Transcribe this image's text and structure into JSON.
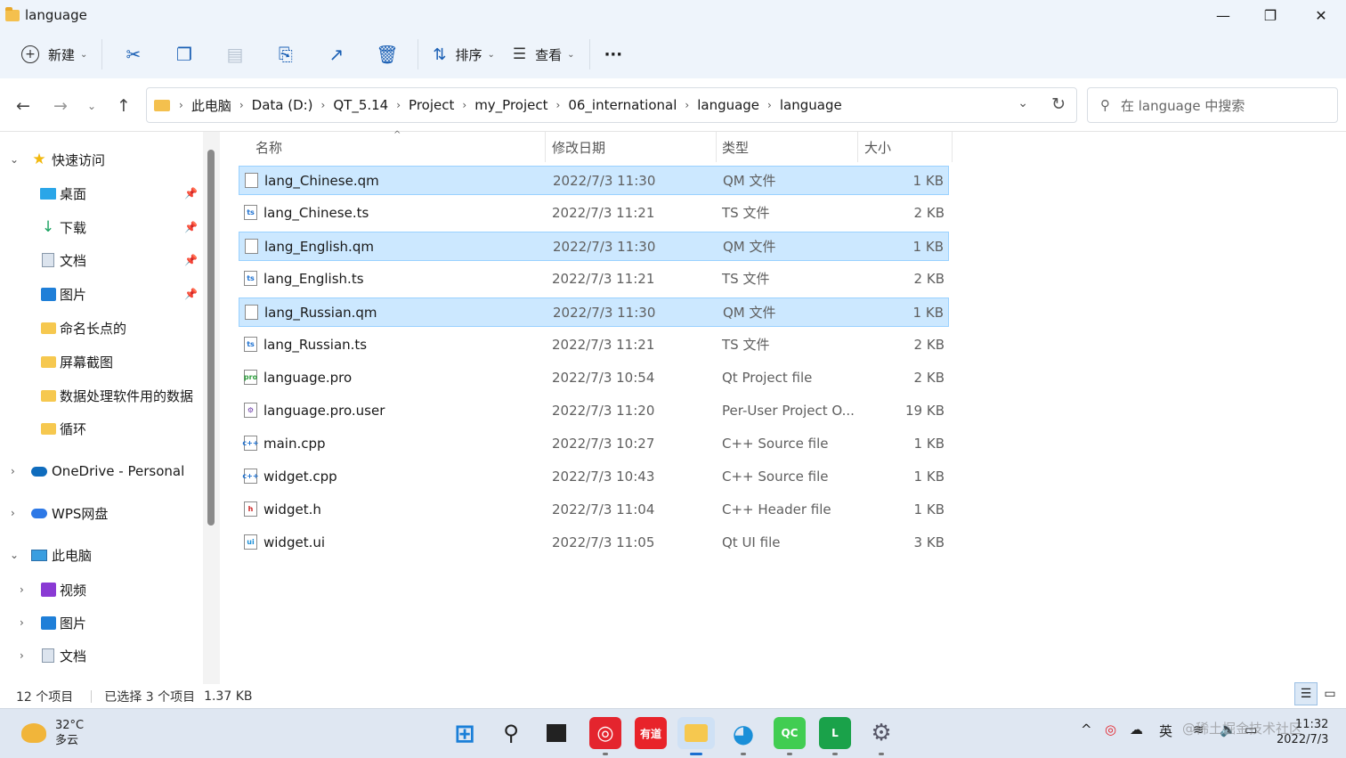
{
  "window": {
    "title": "language",
    "minimize": "—",
    "maximize": "❐",
    "close": "✕"
  },
  "toolbar": {
    "new_label": "新建",
    "sort_label": "排序",
    "view_label": "查看",
    "more_label": "···"
  },
  "address": {
    "crumbs": [
      "此电脑",
      "Data (D:)",
      "QT_5.14",
      "Project",
      "my_Project",
      "06_international",
      "language",
      "language"
    ]
  },
  "search": {
    "placeholder": "在 language 中搜索"
  },
  "sidebar": {
    "quick_access": "快速访问",
    "items": [
      {
        "label": "桌面",
        "icon": "desktop-icon"
      },
      {
        "label": "下载",
        "icon": "download-icon"
      },
      {
        "label": "文档",
        "icon": "document-icon"
      },
      {
        "label": "图片",
        "icon": "pictures-icon"
      },
      {
        "label": "命名长点的",
        "icon": "folder-icon"
      },
      {
        "label": "屏幕截图",
        "icon": "folder-icon"
      },
      {
        "label": "数据处理软件用的数据",
        "icon": "folder-icon"
      },
      {
        "label": "循环",
        "icon": "folder-icon"
      }
    ],
    "onedrive": "OneDrive - Personal",
    "wps": "WPS网盘",
    "this_pc": "此电脑",
    "pc_items": [
      {
        "label": "视频",
        "icon": "video-icon"
      },
      {
        "label": "图片",
        "icon": "pictures-icon"
      },
      {
        "label": "文档",
        "icon": "document-icon"
      }
    ]
  },
  "columns": {
    "name": "名称",
    "date": "修改日期",
    "type": "类型",
    "size": "大小"
  },
  "files": [
    {
      "name": "lang_Chinese.qm",
      "date": "2022/7/3 11:30",
      "type": "QM 文件",
      "size": "1 KB",
      "selected": true,
      "icon": "qm-file-icon"
    },
    {
      "name": "lang_Chinese.ts",
      "date": "2022/7/3 11:21",
      "type": "TS 文件",
      "size": "2 KB",
      "selected": false,
      "icon": "ts-file-icon"
    },
    {
      "name": "lang_English.qm",
      "date": "2022/7/3 11:30",
      "type": "QM 文件",
      "size": "1 KB",
      "selected": true,
      "icon": "qm-file-icon"
    },
    {
      "name": "lang_English.ts",
      "date": "2022/7/3 11:21",
      "type": "TS 文件",
      "size": "2 KB",
      "selected": false,
      "icon": "ts-file-icon"
    },
    {
      "name": "lang_Russian.qm",
      "date": "2022/7/3 11:30",
      "type": "QM 文件",
      "size": "1 KB",
      "selected": true,
      "icon": "qm-file-icon"
    },
    {
      "name": "lang_Russian.ts",
      "date": "2022/7/3 11:21",
      "type": "TS 文件",
      "size": "2 KB",
      "selected": false,
      "icon": "ts-file-icon"
    },
    {
      "name": "language.pro",
      "date": "2022/7/3 10:54",
      "type": "Qt Project file",
      "size": "2 KB",
      "selected": false,
      "icon": "pro-file-icon"
    },
    {
      "name": "language.pro.user",
      "date": "2022/7/3 11:20",
      "type": "Per-User Project O...",
      "size": "19 KB",
      "selected": false,
      "icon": "user-file-icon"
    },
    {
      "name": "main.cpp",
      "date": "2022/7/3 10:27",
      "type": "C++ Source file",
      "size": "1 KB",
      "selected": false,
      "icon": "cpp-file-icon"
    },
    {
      "name": "widget.cpp",
      "date": "2022/7/3 10:43",
      "type": "C++ Source file",
      "size": "1 KB",
      "selected": false,
      "icon": "cpp-file-icon"
    },
    {
      "name": "widget.h",
      "date": "2022/7/3 11:04",
      "type": "C++ Header file",
      "size": "1 KB",
      "selected": false,
      "icon": "header-file-icon"
    },
    {
      "name": "widget.ui",
      "date": "2022/7/3 11:05",
      "type": "Qt UI file",
      "size": "3 KB",
      "selected": false,
      "icon": "ui-file-icon"
    }
  ],
  "status": {
    "count": "12 个项目",
    "selected": "已选择 3 个项目",
    "size": "1.37 KB"
  },
  "taskbar": {
    "temp": "32°C",
    "weather": "多云",
    "youdao": "有道",
    "qc": "QC",
    "ime": "英",
    "time": "11:32",
    "date": "2022/7/3",
    "watermark": "@稀土掘金技术社区"
  }
}
